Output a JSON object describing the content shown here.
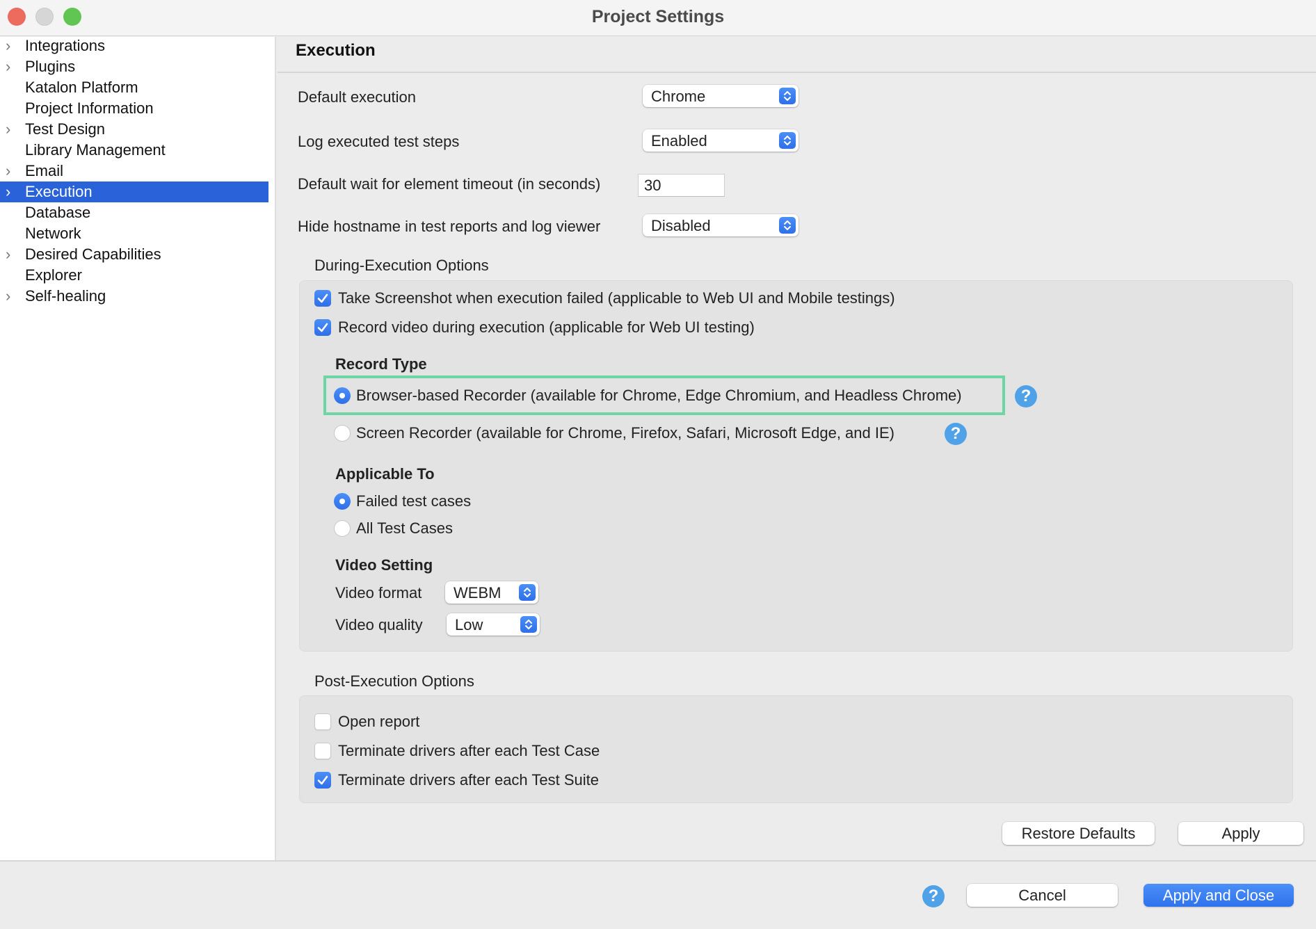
{
  "window": {
    "title": "Project Settings"
  },
  "sidebar": {
    "items": [
      {
        "label": "Integrations",
        "expandable": true,
        "selected": false
      },
      {
        "label": "Plugins",
        "expandable": true,
        "selected": false
      },
      {
        "label": "Katalon Platform",
        "expandable": false,
        "selected": false
      },
      {
        "label": "Project Information",
        "expandable": false,
        "selected": false
      },
      {
        "label": "Test Design",
        "expandable": true,
        "selected": false
      },
      {
        "label": "Library Management",
        "expandable": false,
        "selected": false
      },
      {
        "label": "Email",
        "expandable": true,
        "selected": false
      },
      {
        "label": "Execution",
        "expandable": true,
        "selected": true
      },
      {
        "label": "Database",
        "expandable": false,
        "selected": false
      },
      {
        "label": "Network",
        "expandable": false,
        "selected": false
      },
      {
        "label": "Desired Capabilities",
        "expandable": true,
        "selected": false
      },
      {
        "label": "Explorer",
        "expandable": false,
        "selected": false
      },
      {
        "label": "Self-healing",
        "expandable": true,
        "selected": false
      }
    ],
    "chevron_glyph": "›"
  },
  "main": {
    "title": "Execution",
    "default_execution": {
      "label": "Default execution",
      "value": "Chrome"
    },
    "log_steps": {
      "label": "Log executed test steps",
      "value": "Enabled"
    },
    "wait_timeout": {
      "label": "Default wait for element timeout (in seconds)",
      "value": "30"
    },
    "hide_hostname": {
      "label": "Hide hostname in test reports and log viewer",
      "value": "Disabled"
    },
    "during": {
      "title": "During-Execution Options",
      "take_screenshot": {
        "label": "Take Screenshot when execution failed (applicable to Web UI and Mobile testings)",
        "checked": true
      },
      "record_video": {
        "label": "Record video during execution (applicable for Web UI testing)",
        "checked": true
      },
      "record_type": {
        "title": "Record Type",
        "options": [
          {
            "label": "Browser-based Recorder (available for Chrome, Edge Chromium, and Headless Chrome)",
            "selected": true
          },
          {
            "label": "Screen Recorder (available for Chrome, Firefox, Safari, Microsoft Edge, and IE)",
            "selected": false
          }
        ]
      },
      "applicable_to": {
        "title": "Applicable To",
        "options": [
          {
            "label": "Failed test cases",
            "selected": true
          },
          {
            "label": "All Test Cases",
            "selected": false
          }
        ]
      },
      "video_setting": {
        "title": "Video Setting",
        "format": {
          "label": "Video format",
          "value": "WEBM"
        },
        "quality": {
          "label": "Video quality",
          "value": "Low"
        }
      }
    },
    "post": {
      "title": "Post-Execution Options",
      "open_report": {
        "label": "Open report",
        "checked": false
      },
      "terminate_case": {
        "label": "Terminate drivers after each Test Case",
        "checked": false
      },
      "terminate_suite": {
        "label": "Terminate drivers after each Test Suite",
        "checked": true
      }
    },
    "restore_defaults": "Restore Defaults",
    "apply": "Apply"
  },
  "footer": {
    "help_glyph": "?",
    "cancel": "Cancel",
    "apply_close": "Apply and Close"
  },
  "colors": {
    "accent": "#2f72ec",
    "selection": "#2a62d9",
    "highlight_border": "#6dd5a6",
    "help_icon": "#4fa2e8"
  }
}
